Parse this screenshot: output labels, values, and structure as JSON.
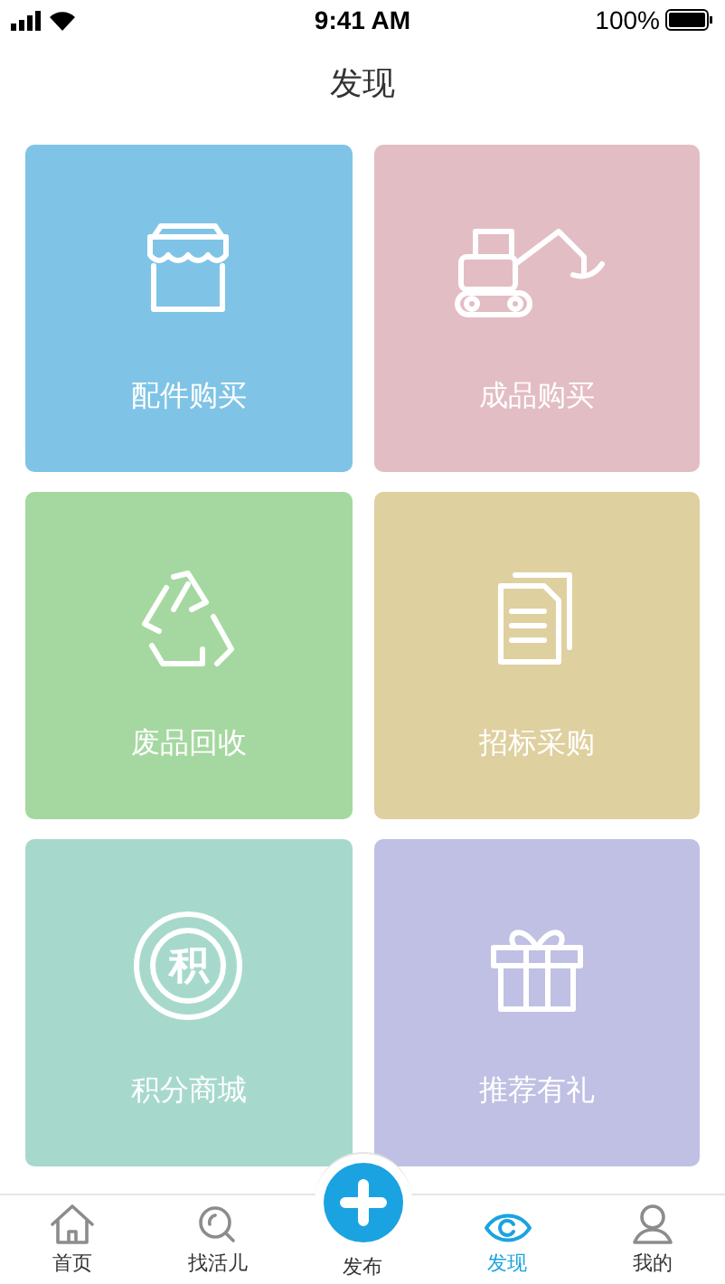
{
  "status_bar": {
    "time": "9:41 AM",
    "battery": "100%"
  },
  "title": "发现",
  "cards": [
    {
      "label": "配件购买",
      "kind": "store",
      "color": "#7fc4e6"
    },
    {
      "label": "成品购买",
      "kind": "excavator",
      "color": "#e3bdc4"
    },
    {
      "label": "废品回收",
      "kind": "recycle",
      "color": "#a5d8a0"
    },
    {
      "label": "招标采购",
      "kind": "document",
      "color": "#dfd0a0"
    },
    {
      "label": "积分商城",
      "kind": "coin",
      "color": "#a6d9cc",
      "icon_text": "积"
    },
    {
      "label": "推荐有礼",
      "kind": "gift",
      "color": "#bfc0e3"
    }
  ],
  "tabs": [
    {
      "label": "首页",
      "kind": "home",
      "selected": false
    },
    {
      "label": "找活儿",
      "kind": "search",
      "selected": false
    },
    {
      "label": "发布",
      "kind": "publish",
      "selected": false
    },
    {
      "label": "发现",
      "kind": "eye",
      "selected": true
    },
    {
      "label": "我的",
      "kind": "person",
      "selected": false
    }
  ]
}
